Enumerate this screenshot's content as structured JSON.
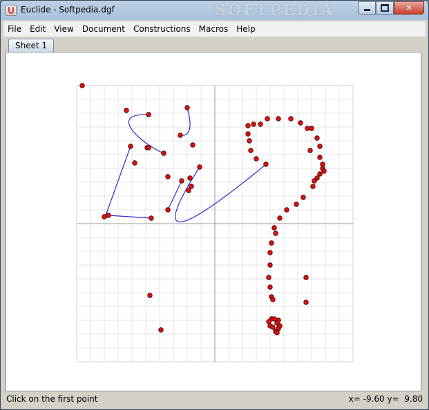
{
  "window": {
    "title": "Euclide - Softpedia.dgf",
    "watermark": "SOFTPEDIA",
    "app_icon": "java-cup-icon"
  },
  "menu": [
    "File",
    "Edit",
    "View",
    "Document",
    "Constructions",
    "Macros",
    "Help"
  ],
  "tabs": [
    {
      "label": "Sheet 1",
      "selected": true
    }
  ],
  "status": {
    "message": "Click on the first point",
    "coords": "x= -9.60 y=  9.80"
  },
  "colors": {
    "point_fill": "#e01010",
    "point_stroke": "#3a0000",
    "curve": "#2a2ad0",
    "grid": "#e4e4e4",
    "axes": "#9a9a9a"
  },
  "board": {
    "x_range": [
      -10,
      10
    ],
    "y_range": [
      -10,
      10
    ],
    "grid_step": 1,
    "points": [
      [
        -9.6,
        10.0
      ],
      [
        -6.4,
        8.2
      ],
      [
        -4.8,
        7.9
      ],
      [
        -2.0,
        8.4
      ],
      [
        -2.5,
        6.4
      ],
      [
        -1.6,
        5.7
      ],
      [
        -6.1,
        5.6
      ],
      [
        -4.9,
        5.5
      ],
      [
        -4.8,
        5.5
      ],
      [
        -3.7,
        5.1
      ],
      [
        -5.8,
        4.4
      ],
      [
        -1.1,
        4.1
      ],
      [
        -3.4,
        3.4
      ],
      [
        -2.4,
        3.1
      ],
      [
        -1.8,
        3.3
      ],
      [
        -1.7,
        2.7
      ],
      [
        -1.9,
        2.4
      ],
      [
        -8.0,
        0.5
      ],
      [
        -7.7,
        0.6
      ],
      [
        -4.6,
        0.4
      ],
      [
        -3.4,
        1.0
      ],
      [
        -4.7,
        -5.2
      ],
      [
        -3.9,
        -7.7
      ],
      [
        2.4,
        7.1
      ],
      [
        2.8,
        7.2
      ],
      [
        3.3,
        7.2
      ],
      [
        3.8,
        7.6
      ],
      [
        4.6,
        7.6
      ],
      [
        5.5,
        7.6
      ],
      [
        6.2,
        7.3
      ],
      [
        6.7,
        6.9
      ],
      [
        7.0,
        6.9
      ],
      [
        2.4,
        6.5
      ],
      [
        2.5,
        6.0
      ],
      [
        2.6,
        5.3
      ],
      [
        3.0,
        4.7
      ],
      [
        3.7,
        4.3
      ],
      [
        6.9,
        5.3
      ],
      [
        7.4,
        6.2
      ],
      [
        7.6,
        5.6
      ],
      [
        7.6,
        4.8
      ],
      [
        7.8,
        4.3
      ],
      [
        7.8,
        4.0
      ],
      [
        7.9,
        3.8
      ],
      [
        7.6,
        3.6
      ],
      [
        7.4,
        3.3
      ],
      [
        7.2,
        3.1
      ],
      [
        7.1,
        2.7
      ],
      [
        6.4,
        1.9
      ],
      [
        5.9,
        1.4
      ],
      [
        5.2,
        1.0
      ],
      [
        4.7,
        0.4
      ],
      [
        4.3,
        -0.3
      ],
      [
        4.4,
        -0.7
      ],
      [
        4.1,
        -1.4
      ],
      [
        4.0,
        -2.1
      ],
      [
        4.0,
        -3.0
      ],
      [
        3.9,
        -3.9
      ],
      [
        4.0,
        -4.6
      ],
      [
        4.1,
        -5.3
      ],
      [
        4.2,
        -5.5
      ],
      [
        6.6,
        -3.9
      ],
      [
        6.6,
        -5.7
      ],
      [
        4.1,
        -6.9
      ],
      [
        4.3,
        -6.9
      ],
      [
        4.6,
        -7.0
      ],
      [
        4.5,
        -7.2
      ],
      [
        4.0,
        -7.4
      ],
      [
        4.2,
        -7.5
      ],
      [
        4.6,
        -7.6
      ],
      [
        4.4,
        -7.8
      ],
      [
        4.5,
        -7.9
      ],
      [
        4.7,
        -7.4
      ],
      [
        3.9,
        -7.1
      ]
    ],
    "curves": [
      {
        "kind": "segment",
        "pts": [
          [
            -6.1,
            5.6
          ],
          [
            -7.9,
            0.6
          ]
        ]
      },
      {
        "kind": "segment",
        "pts": [
          [
            -7.7,
            0.6
          ],
          [
            -4.6,
            0.4
          ]
        ]
      },
      {
        "kind": "cubic",
        "pts": [
          [
            -4.8,
            7.9
          ],
          [
            -8.0,
            8.0
          ],
          [
            -5.0,
            5.6
          ],
          [
            -3.7,
            5.1
          ]
        ]
      },
      {
        "kind": "cubic",
        "pts": [
          [
            -2.0,
            8.4
          ],
          [
            -1.6,
            7.0
          ],
          [
            -1.8,
            6.3
          ],
          [
            -2.5,
            6.4
          ]
        ]
      },
      {
        "kind": "segment",
        "pts": [
          [
            -3.4,
            1.0
          ],
          [
            -2.4,
            3.1
          ]
        ]
      },
      {
        "kind": "cubic",
        "pts": [
          [
            -1.1,
            4.1
          ],
          [
            -5.0,
            -2.0
          ],
          [
            -2.0,
            -0.4
          ],
          [
            3.7,
            4.3
          ]
        ]
      }
    ]
  }
}
